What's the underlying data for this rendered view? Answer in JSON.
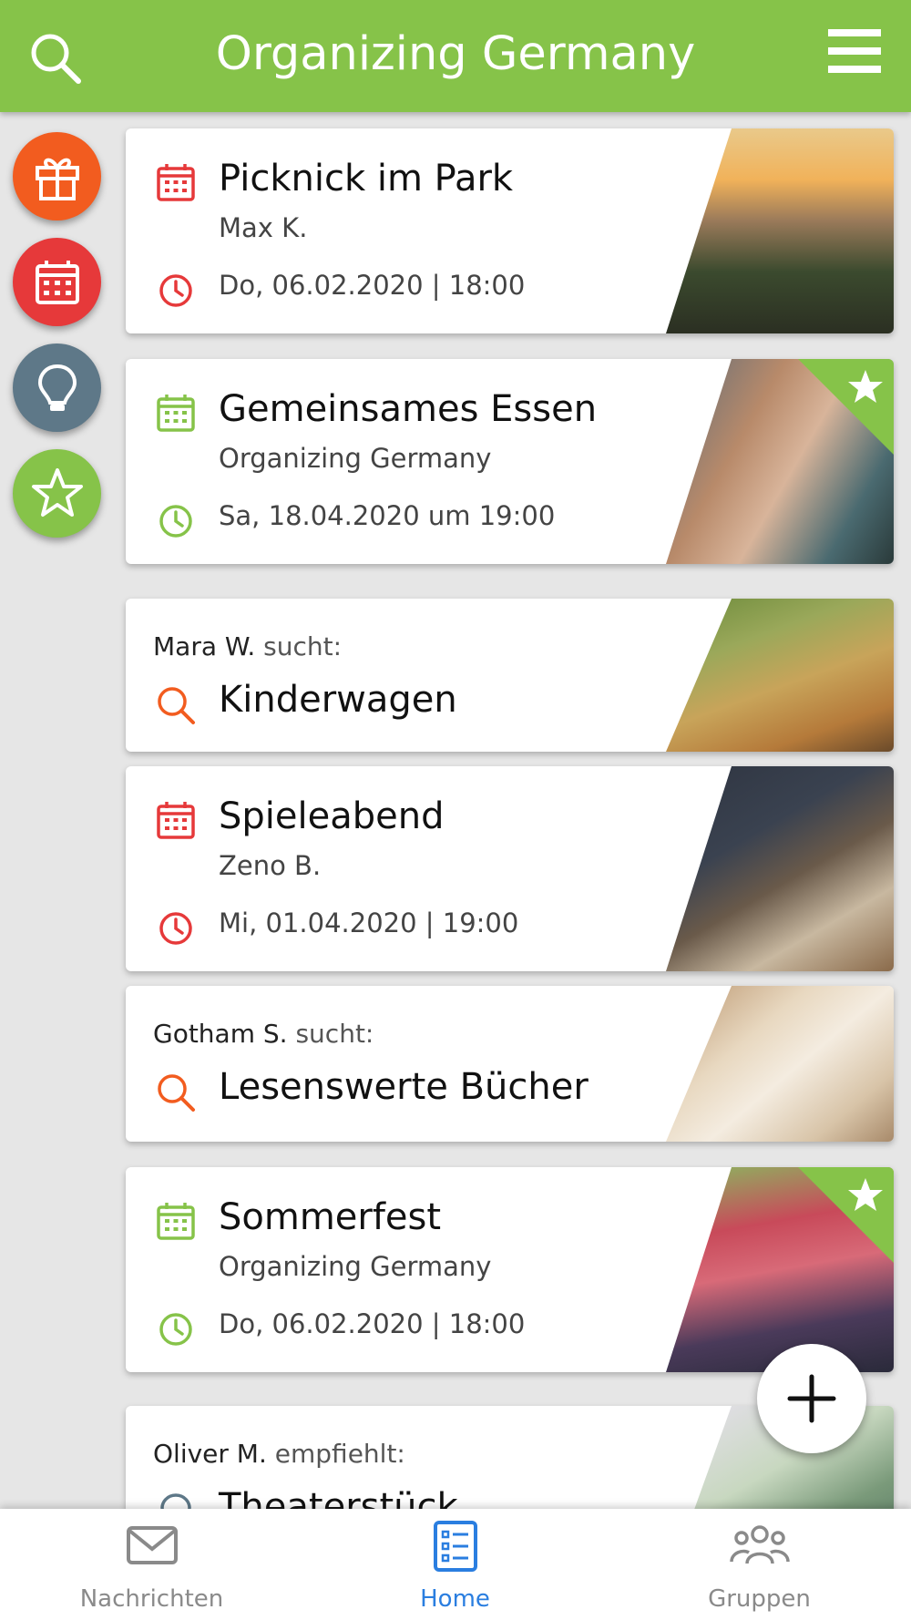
{
  "header": {
    "title": "Organizing Germany"
  },
  "sidebar": {
    "buttons": [
      {
        "name": "gift",
        "color": "#f25c1f"
      },
      {
        "name": "calendar",
        "color": "#e6393a"
      },
      {
        "name": "idea",
        "color": "#5e7888"
      },
      {
        "name": "favorites",
        "color": "#86c349"
      }
    ]
  },
  "feed": {
    "cards": [
      {
        "type": "event",
        "title": "Picknick im Park",
        "subtitle": "Max K.",
        "date": "Do, 06.02.2020 | 18:00",
        "accent": "#e6393a",
        "starred": false
      },
      {
        "type": "event",
        "title": "Gemeinsames Essen",
        "subtitle": "Organizing Germany",
        "date": "Sa, 18.04.2020 um 19:00",
        "accent": "#86c349",
        "starred": true
      },
      {
        "type": "search",
        "who": "Mara W.",
        "verb": "sucht:",
        "title": "Kinderwagen",
        "accent": "#f25c1f"
      },
      {
        "type": "event",
        "title": "Spieleabend",
        "subtitle": "Zeno B.",
        "date": "Mi, 01.04.2020 | 19:00",
        "accent": "#e6393a",
        "starred": false
      },
      {
        "type": "search",
        "who": "Gotham S.",
        "verb": "sucht:",
        "title": "Lesenswerte Bücher",
        "accent": "#f25c1f"
      },
      {
        "type": "event",
        "title": "Sommerfest",
        "subtitle": "Organizing Germany",
        "date": "Do, 06.02.2020 | 18:00",
        "accent": "#86c349",
        "starred": true
      },
      {
        "type": "recommend",
        "who": "Oliver M.",
        "verb": "empfiehlt:",
        "title": "Theaterstück",
        "accent": "#5e7888"
      }
    ]
  },
  "bottom_nav": {
    "items": [
      {
        "label": "Nachrichten",
        "icon": "envelope-icon",
        "active": false
      },
      {
        "label": "Home",
        "icon": "list-icon",
        "active": true
      },
      {
        "label": "Gruppen",
        "icon": "group-icon",
        "active": false
      }
    ],
    "active_color": "#2a7ee0",
    "inactive_color": "#8a8a8a"
  }
}
